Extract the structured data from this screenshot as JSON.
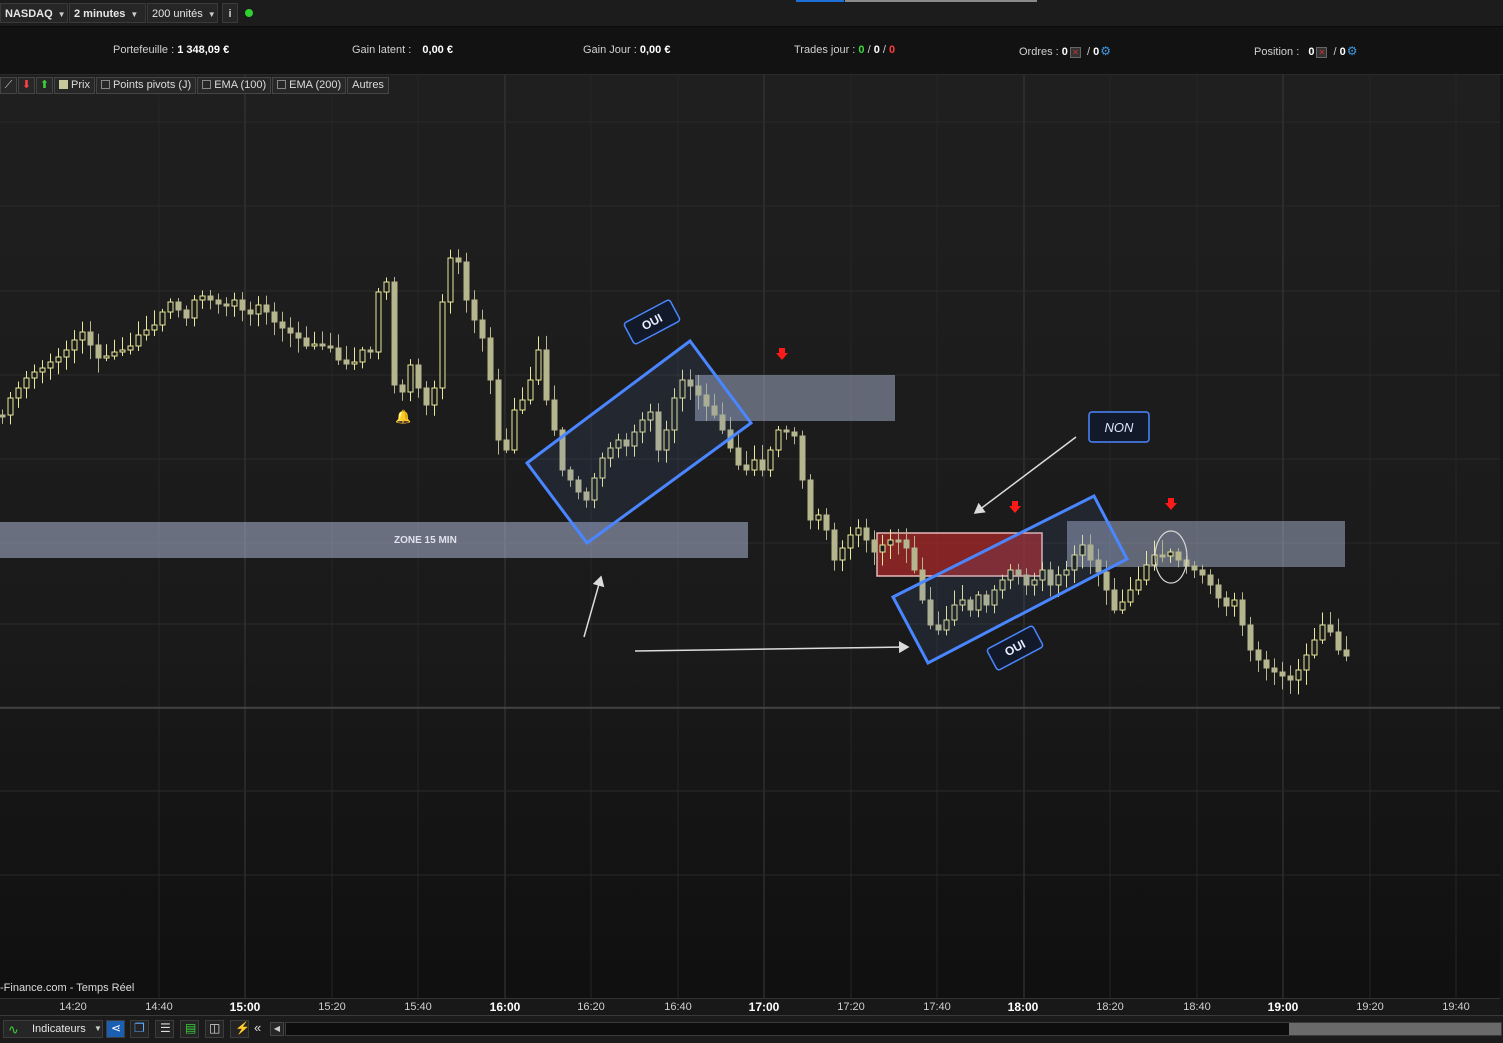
{
  "toolbar": {
    "instrument": "NASDAQ",
    "timeframe": "2 minutes",
    "units": "200 unités",
    "info_icon": "info-icon",
    "status_color": "#2fd02f"
  },
  "infobar": {
    "portfolio_label": "Portefeuille :",
    "portfolio_value": "1 348,09 €",
    "latent_label": "Gain latent :",
    "latent_value": "0,00 €",
    "day_label": "Gain Jour :",
    "day_value": "0,00 €",
    "trades_label": "Trades jour :",
    "trades_a": "0",
    "trades_b": "0",
    "trades_c": "0",
    "orders_label": "Ordres :",
    "orders_a": "0",
    "orders_b": "0",
    "position_label": "Position :",
    "position_a": "0",
    "position_b": "0"
  },
  "legend": {
    "price": "Prix",
    "pivots": "Points pivots (J)",
    "ema100": "EMA (100)",
    "ema200": "EMA (200)",
    "others": "Autres"
  },
  "annotations": {
    "zone_label": "ZONE 15 MIN",
    "yes_1": "OUI",
    "yes_2": "OUI",
    "no": "NON"
  },
  "source": "-Finance.com - Temps Réel",
  "bottombar": {
    "indicators": "Indicateurs"
  },
  "colors": {
    "candle_up": "#e8e89a",
    "candle_down": "#b5b58e",
    "zone_fill": "#aab4d2",
    "box_stroke": "#4a86ff",
    "red_zone": "#a82828",
    "signal_arrow": "#ff1a1a"
  },
  "chart_data": {
    "type": "candlestick",
    "x_tick_labels": [
      "14:20",
      "14:40",
      "15:00",
      "15:20",
      "15:40",
      "16:00",
      "16:20",
      "16:40",
      "17:00",
      "17:20",
      "17:40",
      "18:00",
      "18:20",
      "18:40",
      "19:00",
      "19:20",
      "19:40"
    ],
    "major_ticks": [
      "15:00",
      "16:00",
      "17:00",
      "18:00",
      "19:00"
    ],
    "candle_interval_minutes": 2,
    "y_axis_visible": false
  }
}
